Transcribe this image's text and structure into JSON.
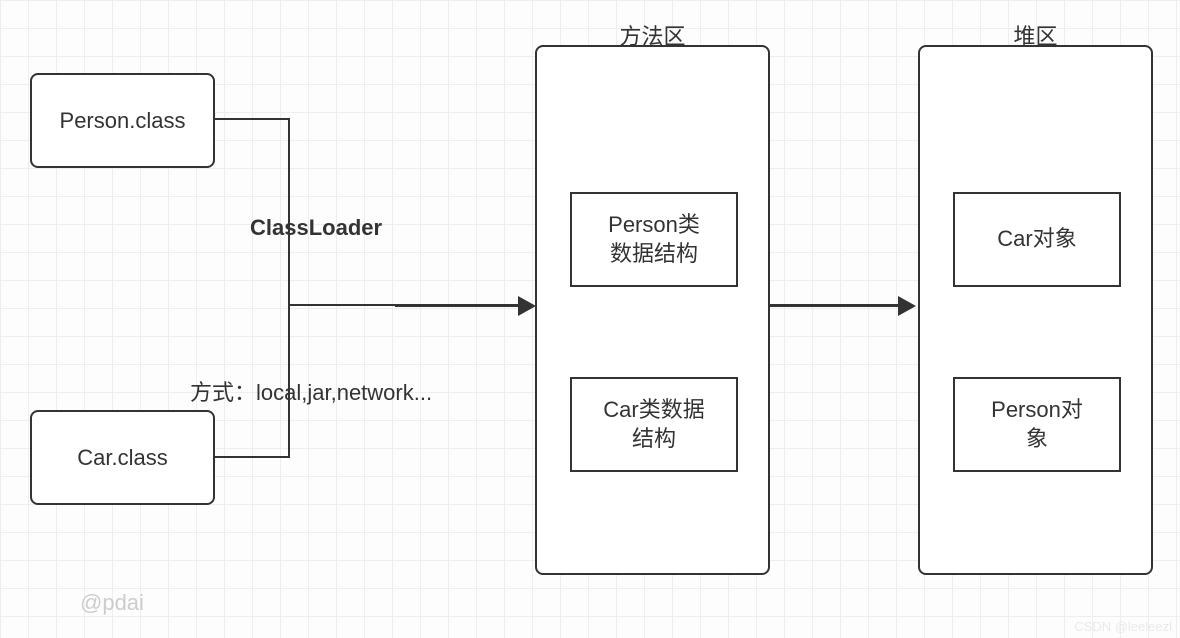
{
  "boxes": {
    "person_class": "Person.class",
    "car_class": "Car.class"
  },
  "labels": {
    "classloader": "ClassLoader",
    "method_desc": "方式：local,jar,network..."
  },
  "method_area": {
    "title": "方法区",
    "person_struct": "Person类\n数据结构",
    "car_struct": "Car类数据\n结构"
  },
  "heap_area": {
    "title": "堆区",
    "car_obj": "Car对象",
    "person_obj": "Person对\n象"
  },
  "watermark": "@pdai",
  "watermark_br": "CSDN @leeleezl"
}
